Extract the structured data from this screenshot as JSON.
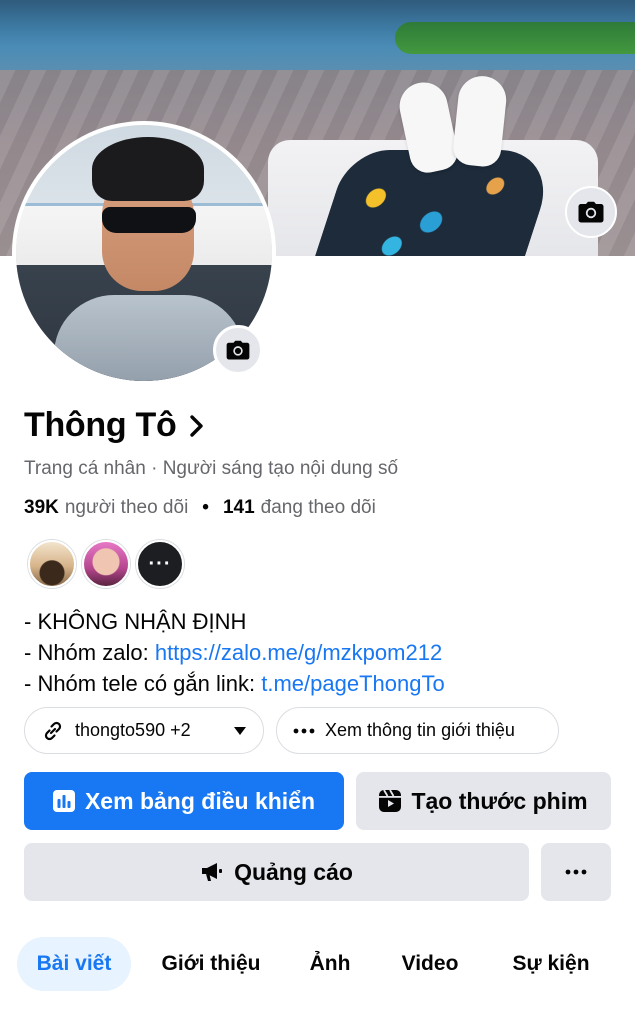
{
  "profile": {
    "name": "Thông Tô",
    "subtitle": "Trang cá nhân · Người sáng tạo nội dung số",
    "followers_count": "39K",
    "followers_label": "người theo dõi",
    "following_count": "141",
    "following_label": "đang theo dõi",
    "stats_separator": "•",
    "friends_more": "···"
  },
  "bio": {
    "line1": "- KHÔNG NHẬN ĐỊNH",
    "line2_prefix": "- Nhóm zalo: ",
    "line2_link": "https://zalo.me/g/mzkpom212",
    "line3_prefix": "- Nhóm tele có gắn link: ",
    "line3_link": "t.me/pageThongTo"
  },
  "chips": {
    "link_label": "thongto590 +2",
    "about_label": "Xem thông tin giới thiệu"
  },
  "buttons": {
    "dashboard": "Xem bảng điều khiển",
    "create_reel": "Tạo thước phim",
    "ads": "Quảng cáo",
    "more": "···"
  },
  "tabs": [
    {
      "label": "Bài viết",
      "active": true
    },
    {
      "label": "Giới thiệu",
      "active": false
    },
    {
      "label": "Ảnh",
      "active": false
    },
    {
      "label": "Video",
      "active": false
    },
    {
      "label": "Sự kiện",
      "active": false
    }
  ],
  "icons": {
    "cover_camera": "camera-icon",
    "avatar_camera": "camera-icon",
    "name_chevron": "chevron-right-icon",
    "link_chip": "link-icon",
    "link_dropdown": "caret-down-icon",
    "about_chip": "more-horizontal-icon",
    "dashboard": "bar-chart-icon",
    "reel": "reel-icon",
    "ads": "megaphone-icon"
  },
  "colors": {
    "accent": "#1877f2",
    "secondary_button": "#e4e6eb",
    "muted_text": "#65676b",
    "active_tab_bg": "#e7f3ff"
  }
}
